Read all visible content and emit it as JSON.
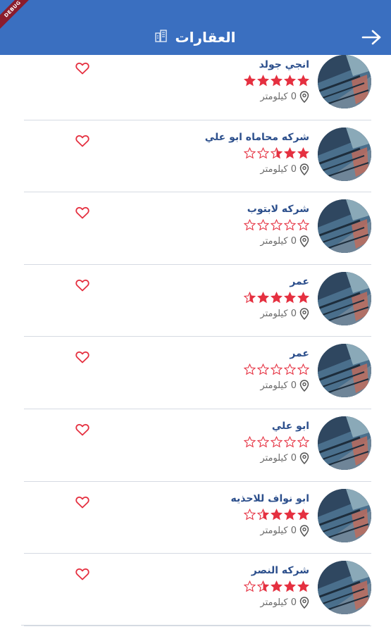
{
  "appbar": {
    "title": "العقارات",
    "debug_label": "DEBUG",
    "color": "#3a6fc0"
  },
  "colors": {
    "accent": "#e53040",
    "name": "#2c4f8c"
  },
  "items": [
    {
      "name": "انجي جولد",
      "rating": 5,
      "distance": "0 كيلومتر"
    },
    {
      "name": "شركه محاماه ابو علي",
      "rating": 2.5,
      "distance": "0 كيلومتر"
    },
    {
      "name": "شركه لابتوب",
      "rating": 0,
      "distance": "0 كيلومتر"
    },
    {
      "name": "عمر",
      "rating": 4.5,
      "distance": "0 كيلومتر"
    },
    {
      "name": "عمر",
      "rating": 0,
      "distance": "0 كيلومتر"
    },
    {
      "name": "ابو علي",
      "rating": 0,
      "distance": "0 كيلومتر"
    },
    {
      "name": "ابو نواف للاحذيه",
      "rating": 3.5,
      "distance": "0 كيلومتر"
    },
    {
      "name": "شركه النصر",
      "rating": 3.5,
      "distance": "0 كيلومتر"
    }
  ]
}
